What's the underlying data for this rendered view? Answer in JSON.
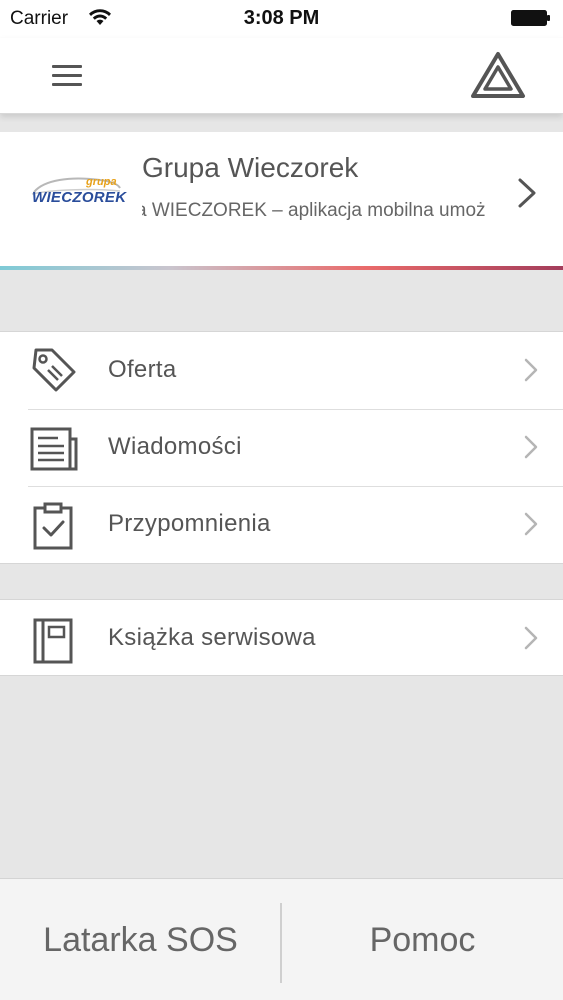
{
  "status_bar": {
    "carrier": "Carrier",
    "time": "3:08 PM"
  },
  "nav": {
    "menu_icon": "hamburger-icon",
    "right_icon": "hazard-triangle-icon"
  },
  "company": {
    "logo_word": "WIECZOREK",
    "logo_grupa": "grupa",
    "title": "Grupa Wieczorek",
    "subtitle": "a WIECZOREK – aplikacja mobilna umoż",
    "chevron_icon": "chevron-right-icon",
    "gradient_colors": [
      "#7ecad6",
      "#c9c5ce",
      "#e96a6a",
      "#a33d5b"
    ]
  },
  "menu": {
    "group1": [
      {
        "label": "Oferta",
        "icon": "price-tag-icon"
      },
      {
        "label": "Wiadomości",
        "icon": "newspaper-icon"
      },
      {
        "label": "Przypomnienia",
        "icon": "clipboard-check-icon"
      }
    ],
    "group2": [
      {
        "label": "Książka serwisowa",
        "icon": "service-book-icon"
      }
    ]
  },
  "bottom_bar": {
    "left_label": "Latarka SOS",
    "right_label": "Pomoc"
  }
}
